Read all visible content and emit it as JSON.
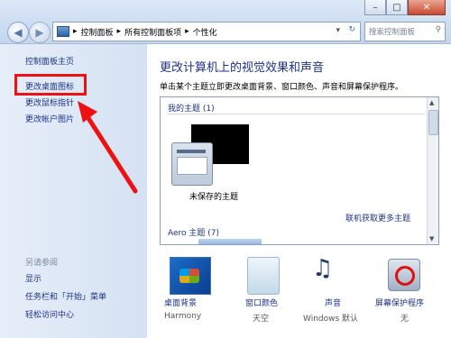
{
  "window": {
    "min": "–",
    "max": "□",
    "close": "✕"
  },
  "addressbar": {
    "crumbs": [
      "控制面板",
      "所有控制面板项",
      "个性化"
    ],
    "separator": "▸",
    "refresh": "↻"
  },
  "search": {
    "placeholder": "搜索控制面板"
  },
  "sidebar": {
    "home": "控制面板主页",
    "links": [
      "更改桌面图标",
      "更改鼠标指针",
      "更改帐户图片"
    ],
    "see_also": "另请参阅",
    "see_also_links": [
      "显示",
      "任务栏和「开始」菜单",
      "轻松访问中心"
    ]
  },
  "main": {
    "title": "更改计算机上的视觉效果和声音",
    "desc": "单击某个主题立即更改桌面背景、窗口颜色、声音和屏幕保护程序。",
    "my_themes": "我的主题 (1)",
    "unsaved": "未保存的主题",
    "online": "联机获取更多主题",
    "aero": "Aero 主题 (7)"
  },
  "bottom": [
    {
      "label": "桌面背景",
      "sub": "Harmony"
    },
    {
      "label": "窗口颜色",
      "sub": "天空"
    },
    {
      "label": "声音",
      "sub": "Windows 默认"
    },
    {
      "label": "屏幕保护程序",
      "sub": "无"
    }
  ],
  "colors": {
    "accent": "#1e3287",
    "highlight": "#ee1111"
  }
}
